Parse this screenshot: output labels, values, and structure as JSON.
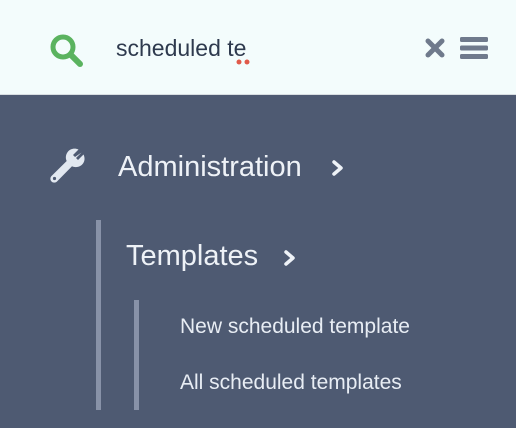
{
  "search": {
    "value": "scheduled te",
    "icon": "search-icon",
    "clear_icon": "close-icon",
    "menu_icon": "hamburger-menu-icon"
  },
  "nav": {
    "administration": {
      "label": "Administration",
      "icon": "wrench-icon"
    },
    "templates": {
      "label": "Templates"
    },
    "links": [
      {
        "label": "New scheduled template"
      },
      {
        "label": "All scheduled templates"
      }
    ]
  },
  "colors": {
    "search_bg": "#f3fcfc",
    "nav_bg": "#4e5a72",
    "accent_green": "#5ab35f",
    "icon_gray": "#6f7a8c",
    "text_light": "#eef2f7"
  }
}
